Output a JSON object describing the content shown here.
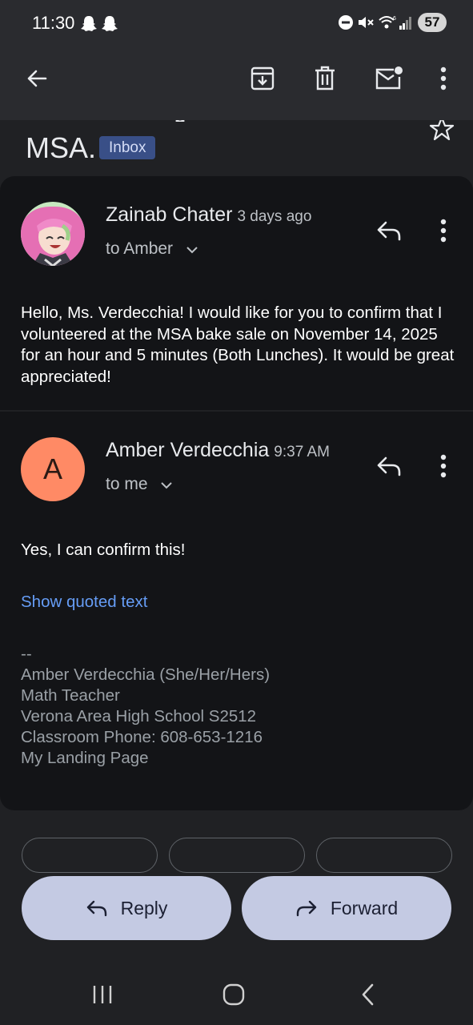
{
  "status_bar": {
    "time": "11:30",
    "battery": "57",
    "icons": [
      "snapchat-icon",
      "snapchat-icon",
      "dnd-icon",
      "mute-icon",
      "wifi-6-icon",
      "signal-icon"
    ]
  },
  "app_bar": {
    "icons": [
      "back-arrow-icon",
      "archive-icon",
      "delete-icon",
      "mark-unread-icon",
      "more-vert-icon"
    ]
  },
  "subject": {
    "text": "MSA.",
    "label": "Inbox"
  },
  "messages": [
    {
      "sender": "Zainab Chater",
      "time": "3 days ago",
      "to": "to Amber",
      "body": "Hello, Ms. Verdecchia! I would like for you to confirm that I volunteered at the MSA bake sale on November 14, 2025 for an hour and 5 minutes (Both Lunches). It would be great appreciated!"
    },
    {
      "sender": "Amber Verdecchia",
      "avatar_letter": "A",
      "time": "9:37 AM",
      "to": "to me",
      "body": "Yes, I can confirm this!",
      "show_quoted": "Show quoted text",
      "signature": {
        "dashes": "--",
        "name": "Amber Verdecchia (She/Her/Hers)",
        "title": "Math Teacher",
        "school": "Verona Area High School S2512",
        "phone": "Classroom Phone: 608-653-1216",
        "link": "My Landing Page"
      }
    }
  ],
  "actions": {
    "reply": "Reply",
    "forward": "Forward"
  },
  "colors": {
    "accent_link": "#669df6",
    "button_bg": "#c4cae3",
    "avatar_bg": "#ff8a65",
    "badge_bg": "#394f87"
  }
}
